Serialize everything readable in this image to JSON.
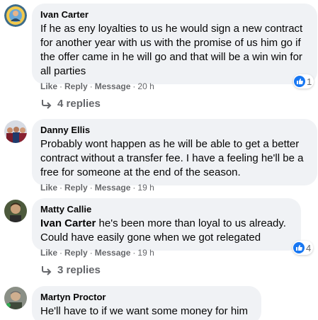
{
  "actions": {
    "like": "Like",
    "reply": "Reply",
    "message": "Message",
    "separator": "·"
  },
  "colors": {
    "bubble": "#f0f2f5",
    "secondary_text": "#65676b",
    "like_blue": "#1877f2"
  },
  "comments": [
    {
      "author": "Ivan Carter",
      "avatar_icon": "profile-photo",
      "text": "If he as eny loyalties to us he would sign a new contract for another year with us with the promise of us him go if the offer came in he will go and that will be a win win for all parties",
      "time": "20 h",
      "reactions": "1",
      "replies": "4 replies"
    },
    {
      "author": "Danny Ellis",
      "avatar_icon": "profile-photo",
      "text": "Probably wont happen as he will be able to get a better contract without a transfer fee. I have a feeling he'll be a free for someone at the end of the season.",
      "time": "19 h"
    },
    {
      "author": "Matty Callie",
      "avatar_icon": "profile-photo",
      "mention": "Ivan Carter",
      "text": " he's been more than loyal to us already. Could have easily gone when we got relegated",
      "time": "19 h",
      "reactions": "4",
      "replies": "3 replies"
    },
    {
      "author": "Martyn Proctor",
      "avatar_icon": "profile-photo",
      "text": "He'll have to if we want some money for him"
    }
  ]
}
